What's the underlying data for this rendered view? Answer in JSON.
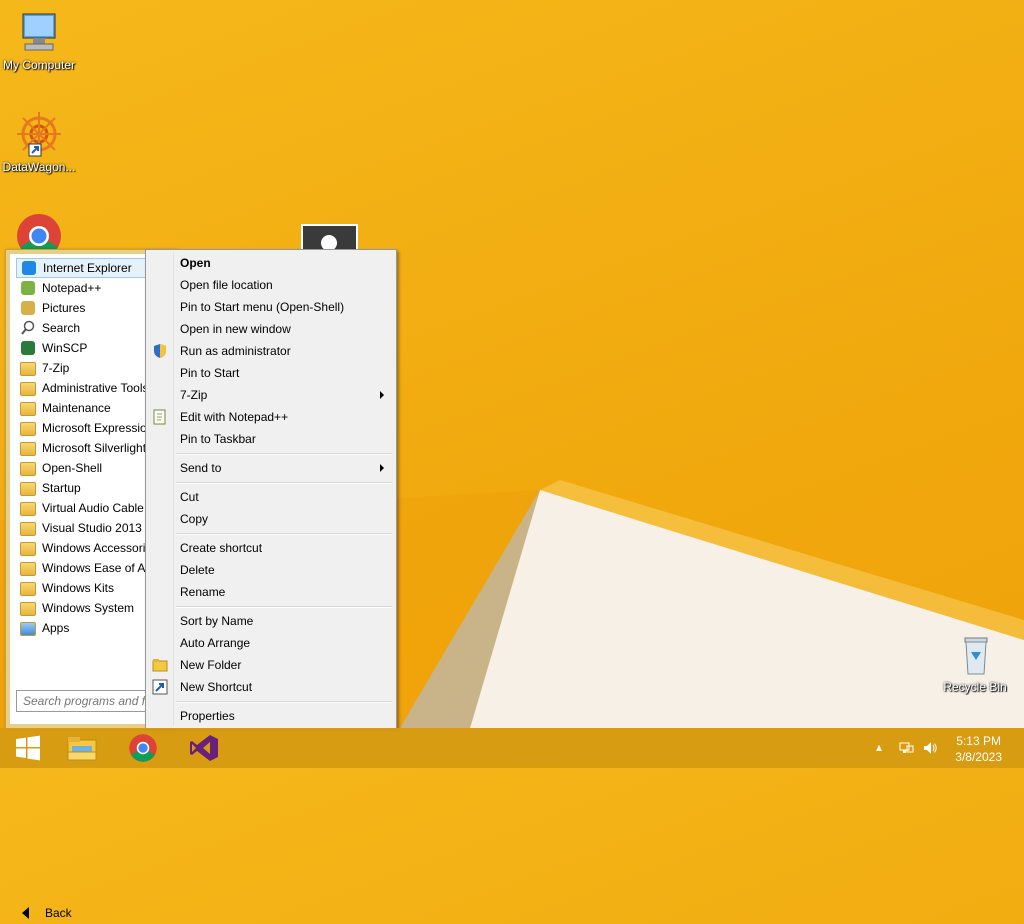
{
  "desktop": {
    "icons": [
      {
        "label": "My Computer",
        "icon": "computer-icon"
      },
      {
        "label": "DataWagon...",
        "icon": "datawagon-shortcut-icon"
      },
      {
        "label": "",
        "icon": "chrome-icon"
      },
      {
        "label": "Recycle Bin",
        "icon": "recycle-bin-icon"
      }
    ]
  },
  "start_menu": {
    "programs": [
      {
        "label": "Internet Explorer",
        "icon": "internet-explorer-icon"
      },
      {
        "label": "Notepad++",
        "icon": "notepad-plus-plus-icon"
      },
      {
        "label": "Pictures",
        "icon": "pictures-icon"
      },
      {
        "label": "Search",
        "icon": "search-icon"
      },
      {
        "label": "WinSCP",
        "icon": "winscp-icon"
      },
      {
        "label": "7-Zip",
        "icon": "folder-icon"
      },
      {
        "label": "Administrative Tools",
        "icon": "folder-icon"
      },
      {
        "label": "Maintenance",
        "icon": "folder-icon"
      },
      {
        "label": "Microsoft Expression",
        "icon": "folder-icon"
      },
      {
        "label": "Microsoft Silverlight",
        "icon": "folder-icon"
      },
      {
        "label": "Open-Shell",
        "icon": "folder-icon"
      },
      {
        "label": "Startup",
        "icon": "folder-icon"
      },
      {
        "label": "Virtual Audio Cable",
        "icon": "folder-icon"
      },
      {
        "label": "Visual Studio 2013",
        "icon": "folder-icon"
      },
      {
        "label": "Windows Accessories",
        "icon": "folder-icon"
      },
      {
        "label": "Windows Ease of Access",
        "icon": "folder-icon"
      },
      {
        "label": "Windows Kits",
        "icon": "folder-icon"
      },
      {
        "label": "Windows System",
        "icon": "folder-icon"
      },
      {
        "label": "Apps",
        "icon": "apps-folder-icon"
      }
    ],
    "back_label": "Back",
    "search_placeholder": "Search programs and files"
  },
  "context_menu": {
    "groups": [
      [
        {
          "label": "Open",
          "bold": true
        },
        {
          "label": "Open file location"
        },
        {
          "label": "Pin to Start menu (Open-Shell)"
        },
        {
          "label": "Open in new window"
        },
        {
          "label": "Run as administrator",
          "icon": "uac-shield-icon"
        },
        {
          "label": "Pin to Start"
        },
        {
          "label": "7-Zip",
          "submenu": true
        },
        {
          "label": "Edit with Notepad++",
          "icon": "notepad-plus-plus-icon"
        },
        {
          "label": "Pin to Taskbar"
        }
      ],
      [
        {
          "label": "Send to",
          "submenu": true
        }
      ],
      [
        {
          "label": "Cut"
        },
        {
          "label": "Copy"
        }
      ],
      [
        {
          "label": "Create shortcut"
        },
        {
          "label": "Delete"
        },
        {
          "label": "Rename"
        }
      ],
      [
        {
          "label": "Sort by Name"
        },
        {
          "label": "Auto Arrange"
        },
        {
          "label": "New Folder",
          "icon": "folder-icon"
        },
        {
          "label": "New Shortcut",
          "icon": "shortcut-icon"
        }
      ],
      [
        {
          "label": "Properties"
        }
      ]
    ]
  },
  "taskbar": {
    "buttons": [
      "windows-start-icon",
      "file-explorer-icon",
      "chrome-icon",
      "visual-studio-icon"
    ],
    "tray_icons": [
      "show-hidden-icons-chevron",
      "network-icon",
      "volume-icon"
    ],
    "time": "5:13 PM",
    "date": "3/8/2023"
  },
  "colors": {
    "wallpaper": "#f2ae12",
    "taskbar": "#d69b14",
    "menu_bg": "#f0f0f0",
    "selection": "#e5f1fb"
  }
}
